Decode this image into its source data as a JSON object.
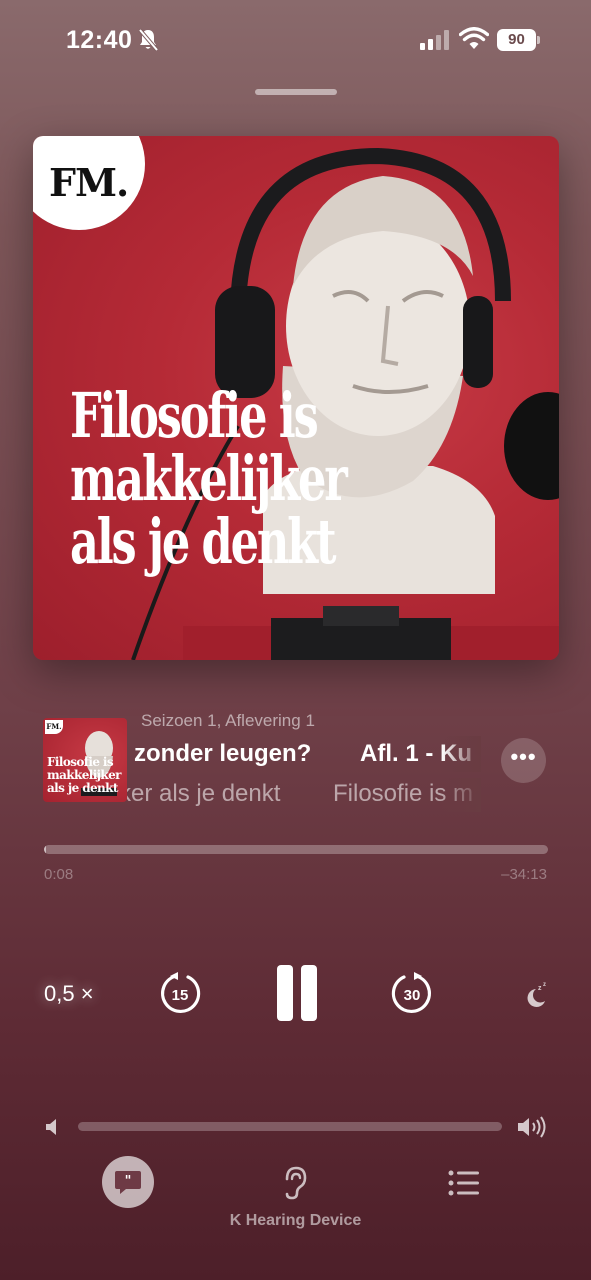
{
  "status_bar": {
    "time": "12:40",
    "battery": "90",
    "icons": [
      "bell-slash-icon",
      "signal-icon",
      "wifi-icon",
      "battery-icon"
    ]
  },
  "artwork": {
    "badge": "FM.",
    "title_lines": [
      "Filosofie is",
      "makkelijker",
      "als je denkt"
    ]
  },
  "now_playing": {
    "season": "Seizoen 1, Aflevering 1",
    "title_a": "zonder leugen?",
    "title_b": "Afl. 1 - Ku",
    "subtitle_a": "ker als je denkt",
    "subtitle_b": "Filosofie is m",
    "thumb_badge": "FM.",
    "thumb_title_lines": [
      "Filosofie is",
      "makkelijker",
      "als je denkt"
    ],
    "more_label": "•••"
  },
  "progress": {
    "elapsed": "0:08",
    "remaining": "–34:13",
    "fraction": 0.004
  },
  "controls": {
    "speed": "0,5 ×",
    "skip_back": "15",
    "skip_forward": "30",
    "state": "playing",
    "icons": [
      "skip-back-15-icon",
      "pause-icon",
      "skip-forward-30-icon",
      "sleep-timer-icon"
    ]
  },
  "volume": {
    "level": 1.0,
    "icons": [
      "speaker-low-icon",
      "speaker-high-icon"
    ]
  },
  "bottom_bar": {
    "device_label": "K Hearing Device",
    "icons": [
      "lyrics-quote-icon",
      "ear-icon",
      "queue-list-icon"
    ]
  },
  "colors": {
    "artwork_red": "#b52a36",
    "background_top": "#8a6a6c",
    "background_bottom": "#4d1f29"
  }
}
